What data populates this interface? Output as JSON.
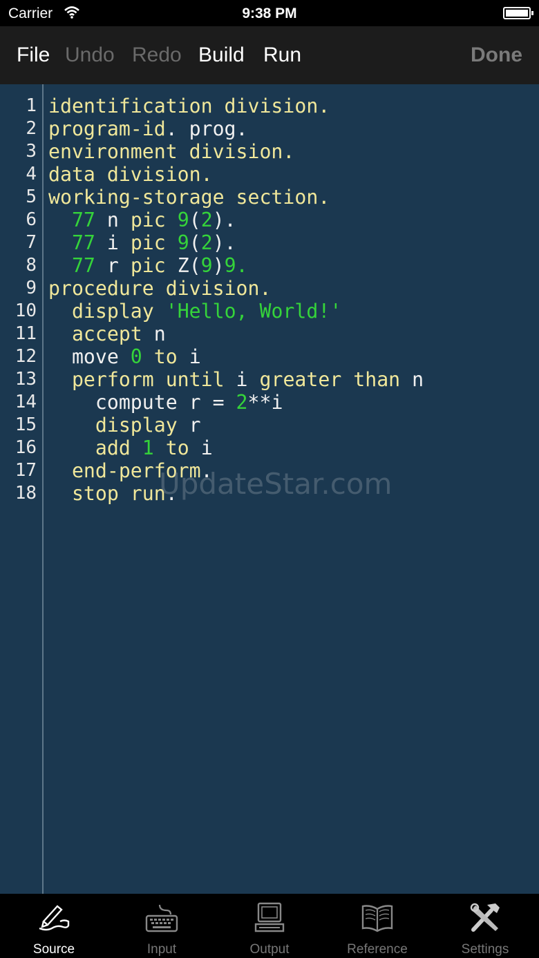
{
  "status": {
    "carrier": "Carrier",
    "time": "9:38 PM"
  },
  "toolbar": {
    "file": "File",
    "undo": "Undo",
    "redo": "Redo",
    "build": "Build",
    "run": "Run",
    "done": "Done"
  },
  "editor": {
    "line_numbers": [
      "1",
      "2",
      "3",
      "4",
      "5",
      "6",
      "7",
      "8",
      "9",
      "10",
      "11",
      "12",
      "13",
      "14",
      "15",
      "16",
      "17",
      "18"
    ],
    "lines": [
      [
        [
          "kw",
          "identification division."
        ]
      ],
      [
        [
          "kw",
          "program-id"
        ],
        [
          "id",
          ". prog."
        ]
      ],
      [
        [
          "kw",
          "environment division."
        ]
      ],
      [
        [
          "kw",
          "data division."
        ]
      ],
      [
        [
          "kw",
          "working-storage section."
        ]
      ],
      [
        [
          "id",
          "  "
        ],
        [
          "num",
          "77"
        ],
        [
          "id",
          " n "
        ],
        [
          "kw",
          "pic"
        ],
        [
          "id",
          " "
        ],
        [
          "num",
          "9"
        ],
        [
          "id",
          "("
        ],
        [
          "num",
          "2"
        ],
        [
          "id",
          ")."
        ]
      ],
      [
        [
          "id",
          "  "
        ],
        [
          "num",
          "77"
        ],
        [
          "id",
          " i "
        ],
        [
          "kw",
          "pic"
        ],
        [
          "id",
          " "
        ],
        [
          "num",
          "9"
        ],
        [
          "id",
          "("
        ],
        [
          "num",
          "2"
        ],
        [
          "id",
          ")."
        ]
      ],
      [
        [
          "id",
          "  "
        ],
        [
          "num",
          "77"
        ],
        [
          "id",
          " r "
        ],
        [
          "kw",
          "pic"
        ],
        [
          "id",
          " Z("
        ],
        [
          "num",
          "9"
        ],
        [
          "id",
          ")"
        ],
        [
          "num",
          "9."
        ]
      ],
      [
        [
          "kw",
          "procedure division."
        ]
      ],
      [
        [
          "id",
          "  "
        ],
        [
          "kw",
          "display"
        ],
        [
          "id",
          " "
        ],
        [
          "str",
          "'Hello, World!'"
        ]
      ],
      [
        [
          "id",
          "  "
        ],
        [
          "kw",
          "accept"
        ],
        [
          "id",
          " n"
        ]
      ],
      [
        [
          "id",
          "  move "
        ],
        [
          "num",
          "0"
        ],
        [
          "id",
          " "
        ],
        [
          "kw",
          "to"
        ],
        [
          "id",
          " i"
        ]
      ],
      [
        [
          "id",
          "  "
        ],
        [
          "kw",
          "perform until"
        ],
        [
          "id",
          " i "
        ],
        [
          "kw",
          "greater than"
        ],
        [
          "id",
          " n"
        ]
      ],
      [
        [
          "id",
          "    compute r = "
        ],
        [
          "num",
          "2"
        ],
        [
          "id",
          "**i"
        ]
      ],
      [
        [
          "id",
          "    "
        ],
        [
          "kw",
          "display"
        ],
        [
          "id",
          " r"
        ]
      ],
      [
        [
          "id",
          "    "
        ],
        [
          "kw",
          "add"
        ],
        [
          "id",
          " "
        ],
        [
          "num",
          "1"
        ],
        [
          "id",
          " "
        ],
        [
          "kw",
          "to"
        ],
        [
          "id",
          " i"
        ]
      ],
      [
        [
          "id",
          "  "
        ],
        [
          "kw",
          "end-perform"
        ],
        [
          "id",
          "."
        ]
      ],
      [
        [
          "id",
          "  "
        ],
        [
          "kw",
          "stop run"
        ],
        [
          "id",
          "."
        ]
      ]
    ]
  },
  "watermark": "UpdateStar.com",
  "tabs": [
    {
      "label": "Source",
      "icon": "pen-icon",
      "active": true
    },
    {
      "label": "Input",
      "icon": "keyboard-icon",
      "active": false
    },
    {
      "label": "Output",
      "icon": "computer-icon",
      "active": false
    },
    {
      "label": "Reference",
      "icon": "book-icon",
      "active": false
    },
    {
      "label": "Settings",
      "icon": "tools-icon",
      "active": false
    }
  ],
  "colors": {
    "keyword": "#f0e79a",
    "number": "#35d43a",
    "text": "#f0f0f0",
    "background": "#1b3850"
  }
}
